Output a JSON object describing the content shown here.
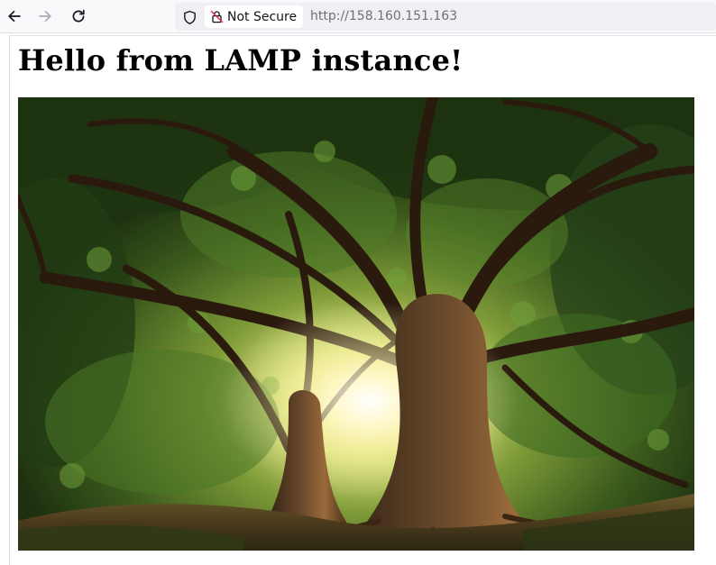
{
  "browser": {
    "security_label": "Not Secure",
    "url": "http://158.160.151.163",
    "icons": {
      "back": "back-arrow-icon",
      "forward": "forward-arrow-icon",
      "reload": "reload-icon",
      "shield": "tracking-protection-shield-icon",
      "security": "insecure-lock-icon"
    }
  },
  "page": {
    "heading": "Hello from LAMP instance!",
    "image_subject": "tree-photo"
  },
  "colors": {
    "toolbar_bg": "#f9f9fb",
    "urlbar_bg": "#f0f0f4",
    "url_text": "#6f6f78",
    "heading_text": "#000000"
  }
}
